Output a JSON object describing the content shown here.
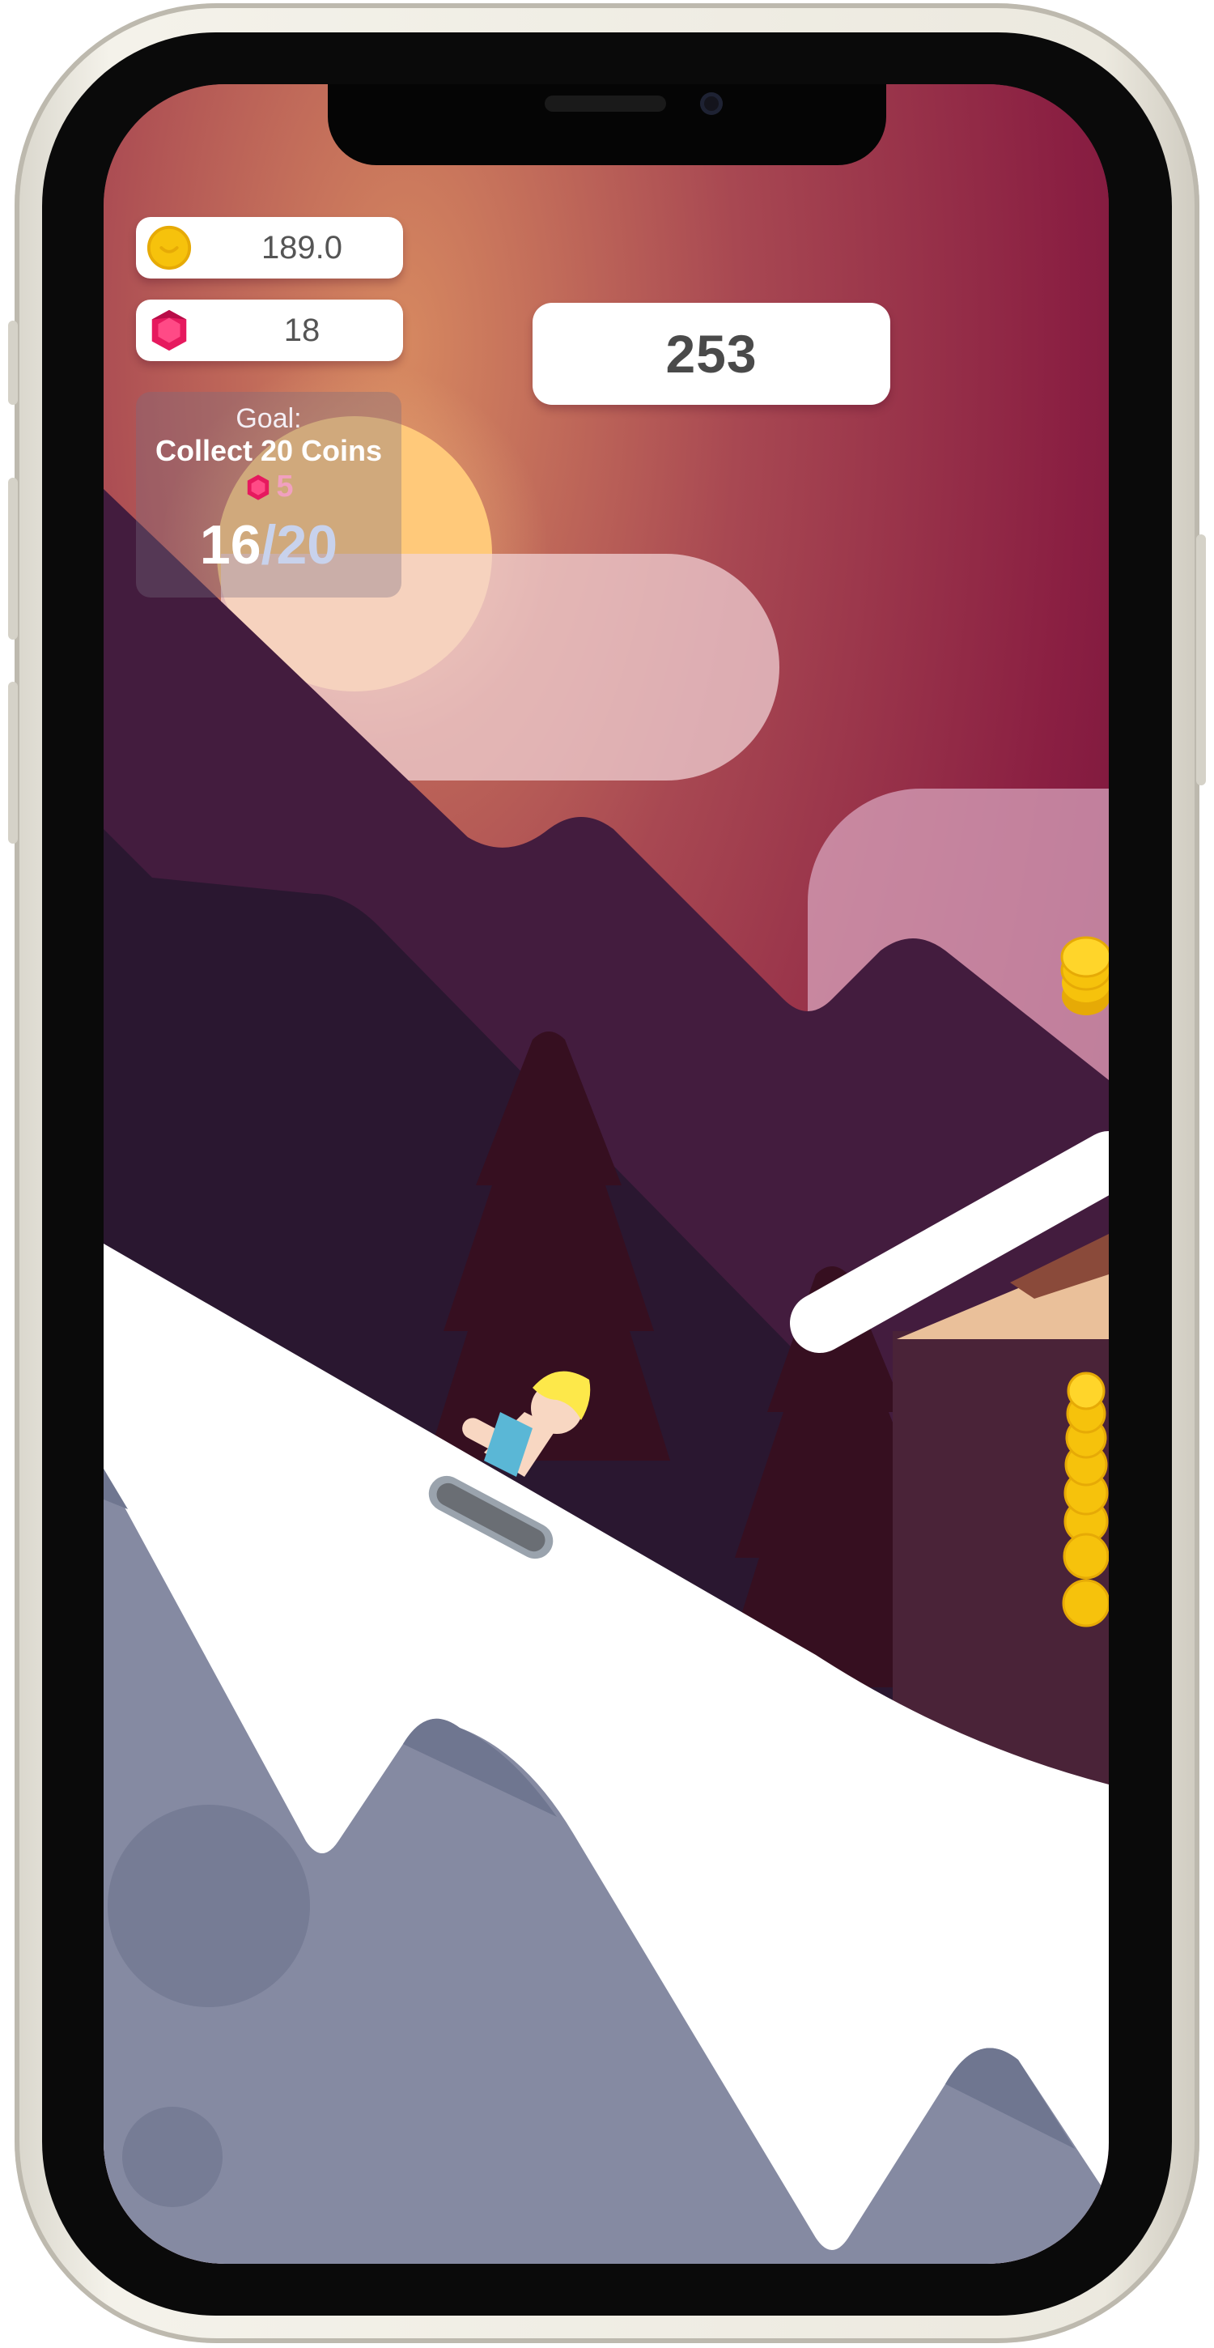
{
  "hud": {
    "coins_value": "189.0",
    "gems_value": "18",
    "score_value": "253",
    "coin_icon": "gold-coin-icon",
    "gem_icon": "pink-gem-icon"
  },
  "goal": {
    "label": "Goal:",
    "text": "Collect 20 Coins",
    "reward_value": "5",
    "progress_current": "16",
    "progress_separator": "/",
    "progress_target": "20"
  },
  "colors": {
    "sky_top": "#8c3a4c",
    "sky_glow": "#d0805e",
    "sky_right": "#6a0c38",
    "sun": "#ffc97a",
    "mountain_far": "#431c3e",
    "mountain_near": "#2a1730",
    "tree": "#360f20",
    "snow": "#ffffff",
    "rocks": "#858aa2",
    "coin": "#f6c20c",
    "gem": "#e6195e",
    "rider_hair": "#fde84a",
    "rider_shirt": "#5ab7d6",
    "sled": "#6a6e74"
  }
}
